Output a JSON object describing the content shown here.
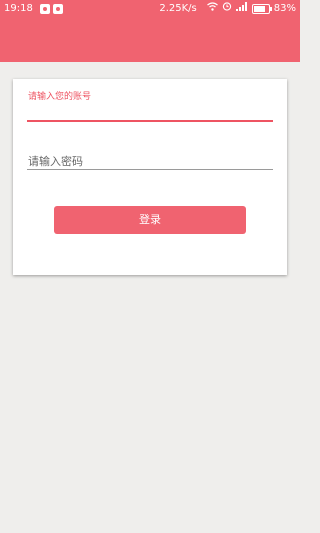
{
  "status_bar": {
    "time": "19:18",
    "network_speed": "2.25K/s",
    "battery_percent": "83%",
    "icons": [
      "qq-icon",
      "penguin-icon",
      "wifi-icon",
      "alarm-icon",
      "signal-icon",
      "battery-icon"
    ]
  },
  "colors": {
    "accent": "#f06370",
    "background": "#efeeec"
  },
  "login_form": {
    "account_label": "请输入您的账号",
    "account_value": "",
    "password_placeholder": "请输入密码",
    "login_button": "登录"
  }
}
